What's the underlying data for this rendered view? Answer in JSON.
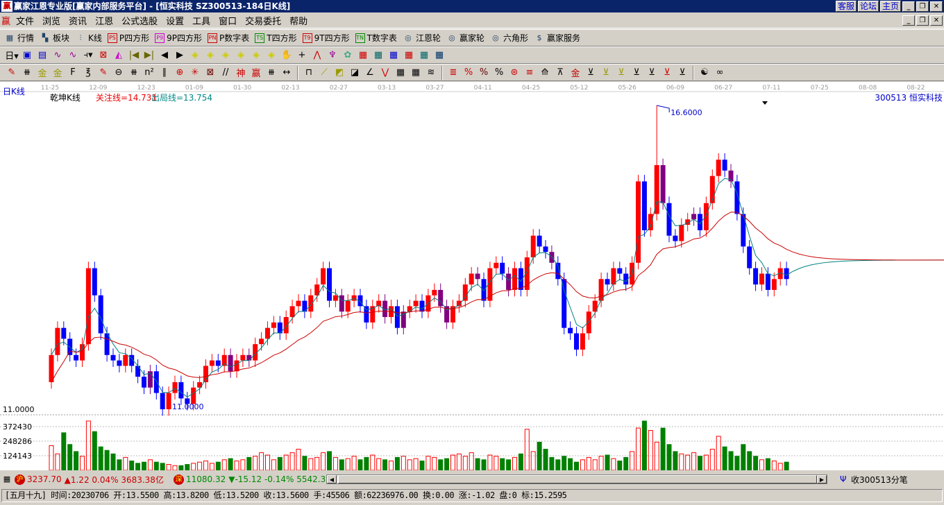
{
  "window": {
    "title": "赢家江恩专业版[赢家内部服务平台] - [恒实科技   SZ300513-184日K线]",
    "links": [
      "客服",
      "论坛",
      "主页"
    ],
    "logo": "赢"
  },
  "menu": [
    "文件",
    "浏览",
    "资讯",
    "江恩",
    "公式选股",
    "设置",
    "工具",
    "窗口",
    "交易委托",
    "帮助"
  ],
  "toolbar1": [
    {
      "icon": "table-icon",
      "g": "▦",
      "label": "行情"
    },
    {
      "icon": "blocks-icon",
      "g": "▚",
      "label": "板块"
    },
    {
      "icon": "candles-icon",
      "g": "⫶",
      "label": "K线"
    },
    {
      "icon": "ps-icon",
      "g": "PS",
      "label": "P四方形",
      "c": "#c00"
    },
    {
      "icon": "p9-icon",
      "g": "P9",
      "label": "9P四方形",
      "c": "#c0c"
    },
    {
      "icon": "pn-icon",
      "g": "PN",
      "label": "P数字表",
      "c": "#c00"
    },
    {
      "icon": "ts-icon",
      "g": "TS",
      "label": "T四方形",
      "c": "#080"
    },
    {
      "icon": "t9-icon",
      "g": "T9",
      "label": "9T四方形",
      "c": "#c00"
    },
    {
      "icon": "tn-icon",
      "g": "TN",
      "label": "T数字表",
      "c": "#080"
    },
    {
      "icon": "wheel-icon",
      "g": "◎",
      "label": "江恩轮"
    },
    {
      "icon": "big-wheel-icon",
      "g": "◎",
      "label": "赢家轮"
    },
    {
      "icon": "hexagon-icon",
      "g": "◎",
      "label": "六角形"
    },
    {
      "icon": "dollar-icon",
      "g": "$",
      "label": "赢家服务"
    }
  ],
  "toolbar2": [
    "日▾",
    "▣",
    "▤",
    "∿",
    "∿",
    "⫞▾",
    "⊠",
    "◭",
    "|◀",
    "▶|",
    "◀",
    "▶",
    "◈",
    "◈",
    "◈",
    "◈",
    "◈",
    "◈",
    "✋",
    "+",
    "⋀",
    "♆",
    "✿",
    "▦",
    "▦",
    "▦",
    "▦",
    "▦",
    "▦"
  ],
  "toolbar3": [
    "✎",
    "⧻",
    "金",
    "金",
    "F",
    "℥",
    "✎",
    "⊖",
    "⧻",
    "n²",
    "∥",
    "⊕",
    "✳",
    "⊠",
    "//",
    "神",
    "赢",
    "⧻",
    "↔",
    "|",
    "⊓",
    "⟋",
    "◩",
    "◪",
    "∠",
    "⋁",
    "▦",
    "▦",
    "≋",
    "|",
    "≣",
    "%",
    "%",
    "%",
    "⊛",
    "≡",
    "⟰",
    "⊼",
    "金",
    "⊻",
    "⊻",
    "⊻",
    "⊻",
    "⊻",
    "⊻",
    "⊻",
    "|",
    "☯",
    "∞"
  ],
  "period_label": "日K线",
  "indicator": {
    "name": "乾坤K线",
    "attention": "关注线=14.731",
    "exit": "出局线=13.754"
  },
  "stock_label": "300513  恒实科技",
  "date_ticks": [
    "11-25",
    "12-09",
    "12-23",
    "01-09",
    "01-30",
    "02-13",
    "02-27",
    "03-13",
    "03-27",
    "04-11",
    "04-25",
    "05-12",
    "05-26",
    "06-09",
    "06-27",
    "07-11",
    "07-25",
    "08-08",
    "08-22"
  ],
  "chart_data": {
    "type": "candlestick",
    "price_range": [
      11.0,
      16.6
    ],
    "high_label": "16.6000",
    "low_label": "11.0000",
    "low_mark": "11.0000",
    "volume_ticks": [
      "372430",
      "248286",
      "124143"
    ],
    "closes": [
      12.0,
      12.5,
      12.3,
      12.0,
      11.9,
      12.2,
      13.6,
      13.1,
      12.4,
      12.0,
      11.9,
      11.8,
      12.0,
      11.8,
      11.6,
      11.4,
      11.7,
      11.3,
      11.0,
      11.3,
      11.5,
      11.2,
      11.1,
      11.4,
      11.5,
      11.8,
      11.9,
      11.8,
      12.0,
      11.7,
      11.9,
      12.0,
      11.9,
      12.2,
      12.3,
      12.5,
      12.6,
      12.4,
      12.7,
      12.9,
      13.0,
      12.8,
      13.1,
      13.3,
      13.6,
      13.0,
      13.1,
      12.8,
      13.0,
      13.1,
      12.9,
      12.6,
      12.9,
      13.0,
      12.7,
      12.9,
      12.5,
      12.8,
      12.9,
      13.0,
      12.8,
      13.1,
      13.2,
      12.9,
      12.6,
      12.9,
      13.0,
      13.3,
      13.5,
      13.4,
      13.0,
      13.6,
      13.7,
      13.5,
      13.2,
      13.6,
      13.2,
      13.8,
      14.2,
      14.0,
      13.9,
      13.7,
      13.4,
      12.5,
      12.4,
      12.1,
      12.4,
      12.8,
      13.0,
      13.4,
      13.3,
      13.6,
      13.5,
      13.3,
      13.7,
      15.2,
      14.3,
      14.6,
      15.5,
      14.8,
      14.2,
      14.1,
      14.4,
      14.5,
      14.6,
      14.3,
      14.8,
      15.3,
      15.6,
      15.4,
      15.2,
      14.6,
      14.0,
      13.6,
      13.3,
      13.5,
      13.2,
      13.4,
      13.6,
      13.4
    ],
    "first_open": 11.5,
    "high_index": 98,
    "purple_indices": [
      16,
      29,
      32,
      47,
      54,
      57,
      63,
      64,
      69,
      74,
      81,
      99,
      104,
      110
    ],
    "volumes": [
      210000,
      140000,
      320000,
      220000,
      160000,
      120000,
      420000,
      330000,
      200000,
      170000,
      140000,
      90000,
      110000,
      80000,
      60000,
      70000,
      90000,
      70000,
      60000,
      50000,
      40000,
      40000,
      50000,
      60000,
      70000,
      80000,
      60000,
      70000,
      90000,
      100000,
      80000,
      90000,
      110000,
      120000,
      150000,
      130000,
      90000,
      110000,
      130000,
      150000,
      180000,
      120000,
      100000,
      110000,
      150000,
      160000,
      110000,
      90000,
      100000,
      120000,
      90000,
      110000,
      130000,
      100000,
      90000,
      80000,
      110000,
      120000,
      90000,
      100000,
      80000,
      120000,
      110000,
      90000,
      100000,
      130000,
      140000,
      120000,
      150000,
      100000,
      90000,
      130000,
      120000,
      100000,
      90000,
      110000,
      140000,
      350000,
      160000,
      240000,
      180000,
      110000,
      90000,
      120000,
      100000,
      70000,
      90000,
      110000,
      90000,
      120000,
      130000,
      100000,
      80000,
      110000,
      160000,
      360000,
      420000,
      340000,
      240000,
      360000,
      220000,
      160000,
      140000,
      130000,
      150000,
      120000,
      130000,
      180000,
      290000,
      200000,
      160000,
      120000,
      220000,
      160000,
      120000,
      90000,
      100000,
      80000,
      60000,
      70000
    ]
  },
  "statusbar": {
    "sh_icon": "沪",
    "sh": "3237.70",
    "sh_chg": "▲1.22 0.04% 3683.38亿",
    "sz_icon": "深",
    "sz": "11080.32",
    "sz_chg": "▼-15.12 -0.14% 5542.3",
    "tick": "收300513分笔"
  },
  "info": "[五月十九] 时间:20230706 开:13.5500 高:13.8200 低:13.5200 收:13.5600 手:45506 额:62236976.00 换:0.00 涨:-1.02 盘:0 标:15.2595",
  "colors": {
    "up": "#ff0000",
    "down": "#0000ff",
    "special": "#800080",
    "ma_fast": "#008080",
    "ma_slow": "#cc0000",
    "vol_up": "#ff0000",
    "vol_down": "#008000"
  }
}
